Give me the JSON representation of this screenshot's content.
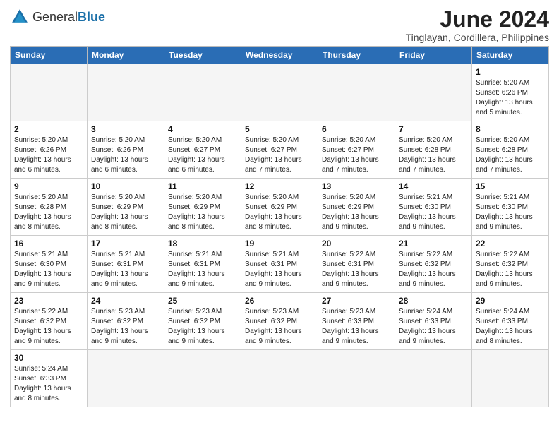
{
  "header": {
    "logo_general": "General",
    "logo_blue": "Blue",
    "month_title": "June 2024",
    "location": "Tinglayan, Cordillera, Philippines"
  },
  "weekdays": [
    "Sunday",
    "Monday",
    "Tuesday",
    "Wednesday",
    "Thursday",
    "Friday",
    "Saturday"
  ],
  "weeks": [
    [
      {
        "day": "",
        "info": ""
      },
      {
        "day": "",
        "info": ""
      },
      {
        "day": "",
        "info": ""
      },
      {
        "day": "",
        "info": ""
      },
      {
        "day": "",
        "info": ""
      },
      {
        "day": "",
        "info": ""
      },
      {
        "day": "1",
        "info": "Sunrise: 5:20 AM\nSunset: 6:26 PM\nDaylight: 13 hours and 5 minutes."
      }
    ],
    [
      {
        "day": "2",
        "info": "Sunrise: 5:20 AM\nSunset: 6:26 PM\nDaylight: 13 hours and 6 minutes."
      },
      {
        "day": "3",
        "info": "Sunrise: 5:20 AM\nSunset: 6:26 PM\nDaylight: 13 hours and 6 minutes."
      },
      {
        "day": "4",
        "info": "Sunrise: 5:20 AM\nSunset: 6:27 PM\nDaylight: 13 hours and 6 minutes."
      },
      {
        "day": "5",
        "info": "Sunrise: 5:20 AM\nSunset: 6:27 PM\nDaylight: 13 hours and 7 minutes."
      },
      {
        "day": "6",
        "info": "Sunrise: 5:20 AM\nSunset: 6:27 PM\nDaylight: 13 hours and 7 minutes."
      },
      {
        "day": "7",
        "info": "Sunrise: 5:20 AM\nSunset: 6:28 PM\nDaylight: 13 hours and 7 minutes."
      },
      {
        "day": "8",
        "info": "Sunrise: 5:20 AM\nSunset: 6:28 PM\nDaylight: 13 hours and 7 minutes."
      }
    ],
    [
      {
        "day": "9",
        "info": "Sunrise: 5:20 AM\nSunset: 6:28 PM\nDaylight: 13 hours and 8 minutes."
      },
      {
        "day": "10",
        "info": "Sunrise: 5:20 AM\nSunset: 6:29 PM\nDaylight: 13 hours and 8 minutes."
      },
      {
        "day": "11",
        "info": "Sunrise: 5:20 AM\nSunset: 6:29 PM\nDaylight: 13 hours and 8 minutes."
      },
      {
        "day": "12",
        "info": "Sunrise: 5:20 AM\nSunset: 6:29 PM\nDaylight: 13 hours and 8 minutes."
      },
      {
        "day": "13",
        "info": "Sunrise: 5:20 AM\nSunset: 6:29 PM\nDaylight: 13 hours and 9 minutes."
      },
      {
        "day": "14",
        "info": "Sunrise: 5:21 AM\nSunset: 6:30 PM\nDaylight: 13 hours and 9 minutes."
      },
      {
        "day": "15",
        "info": "Sunrise: 5:21 AM\nSunset: 6:30 PM\nDaylight: 13 hours and 9 minutes."
      }
    ],
    [
      {
        "day": "16",
        "info": "Sunrise: 5:21 AM\nSunset: 6:30 PM\nDaylight: 13 hours and 9 minutes."
      },
      {
        "day": "17",
        "info": "Sunrise: 5:21 AM\nSunset: 6:31 PM\nDaylight: 13 hours and 9 minutes."
      },
      {
        "day": "18",
        "info": "Sunrise: 5:21 AM\nSunset: 6:31 PM\nDaylight: 13 hours and 9 minutes."
      },
      {
        "day": "19",
        "info": "Sunrise: 5:21 AM\nSunset: 6:31 PM\nDaylight: 13 hours and 9 minutes."
      },
      {
        "day": "20",
        "info": "Sunrise: 5:22 AM\nSunset: 6:31 PM\nDaylight: 13 hours and 9 minutes."
      },
      {
        "day": "21",
        "info": "Sunrise: 5:22 AM\nSunset: 6:32 PM\nDaylight: 13 hours and 9 minutes."
      },
      {
        "day": "22",
        "info": "Sunrise: 5:22 AM\nSunset: 6:32 PM\nDaylight: 13 hours and 9 minutes."
      }
    ],
    [
      {
        "day": "23",
        "info": "Sunrise: 5:22 AM\nSunset: 6:32 PM\nDaylight: 13 hours and 9 minutes."
      },
      {
        "day": "24",
        "info": "Sunrise: 5:23 AM\nSunset: 6:32 PM\nDaylight: 13 hours and 9 minutes."
      },
      {
        "day": "25",
        "info": "Sunrise: 5:23 AM\nSunset: 6:32 PM\nDaylight: 13 hours and 9 minutes."
      },
      {
        "day": "26",
        "info": "Sunrise: 5:23 AM\nSunset: 6:32 PM\nDaylight: 13 hours and 9 minutes."
      },
      {
        "day": "27",
        "info": "Sunrise: 5:23 AM\nSunset: 6:33 PM\nDaylight: 13 hours and 9 minutes."
      },
      {
        "day": "28",
        "info": "Sunrise: 5:24 AM\nSunset: 6:33 PM\nDaylight: 13 hours and 9 minutes."
      },
      {
        "day": "29",
        "info": "Sunrise: 5:24 AM\nSunset: 6:33 PM\nDaylight: 13 hours and 8 minutes."
      }
    ],
    [
      {
        "day": "30",
        "info": "Sunrise: 5:24 AM\nSunset: 6:33 PM\nDaylight: 13 hours and 8 minutes."
      },
      {
        "day": "",
        "info": ""
      },
      {
        "day": "",
        "info": ""
      },
      {
        "day": "",
        "info": ""
      },
      {
        "day": "",
        "info": ""
      },
      {
        "day": "",
        "info": ""
      },
      {
        "day": "",
        "info": ""
      }
    ]
  ]
}
